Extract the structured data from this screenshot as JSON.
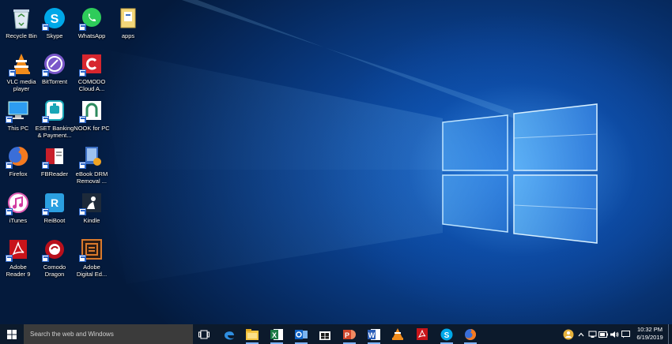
{
  "desktop": {
    "icons": [
      {
        "label": "Recycle Bin"
      },
      {
        "label": "Skype"
      },
      {
        "label": "WhatsApp"
      },
      {
        "label": "apps"
      },
      {
        "label": "VLC media\nplayer"
      },
      {
        "label": "BitTorrent"
      },
      {
        "label": "COMODO\nCloud A..."
      },
      {
        "label": "This PC"
      },
      {
        "label": "ESET Banking\n& Payment..."
      },
      {
        "label": "NOOK for PC"
      },
      {
        "label": "Firefox"
      },
      {
        "label": "FBReader"
      },
      {
        "label": "eBook DRM\nRemoval ..."
      },
      {
        "label": "iTunes"
      },
      {
        "label": "ReiBoot"
      },
      {
        "label": "Kindle"
      },
      {
        "label": "Adobe\nReader 9"
      },
      {
        "label": "Comodo\nDragon"
      },
      {
        "label": "Adobe\nDigital Ed..."
      }
    ]
  },
  "taskbar": {
    "search_placeholder": "Search the web and Windows",
    "clock_time": "10:32 PM",
    "clock_date": "6/19/2019"
  }
}
